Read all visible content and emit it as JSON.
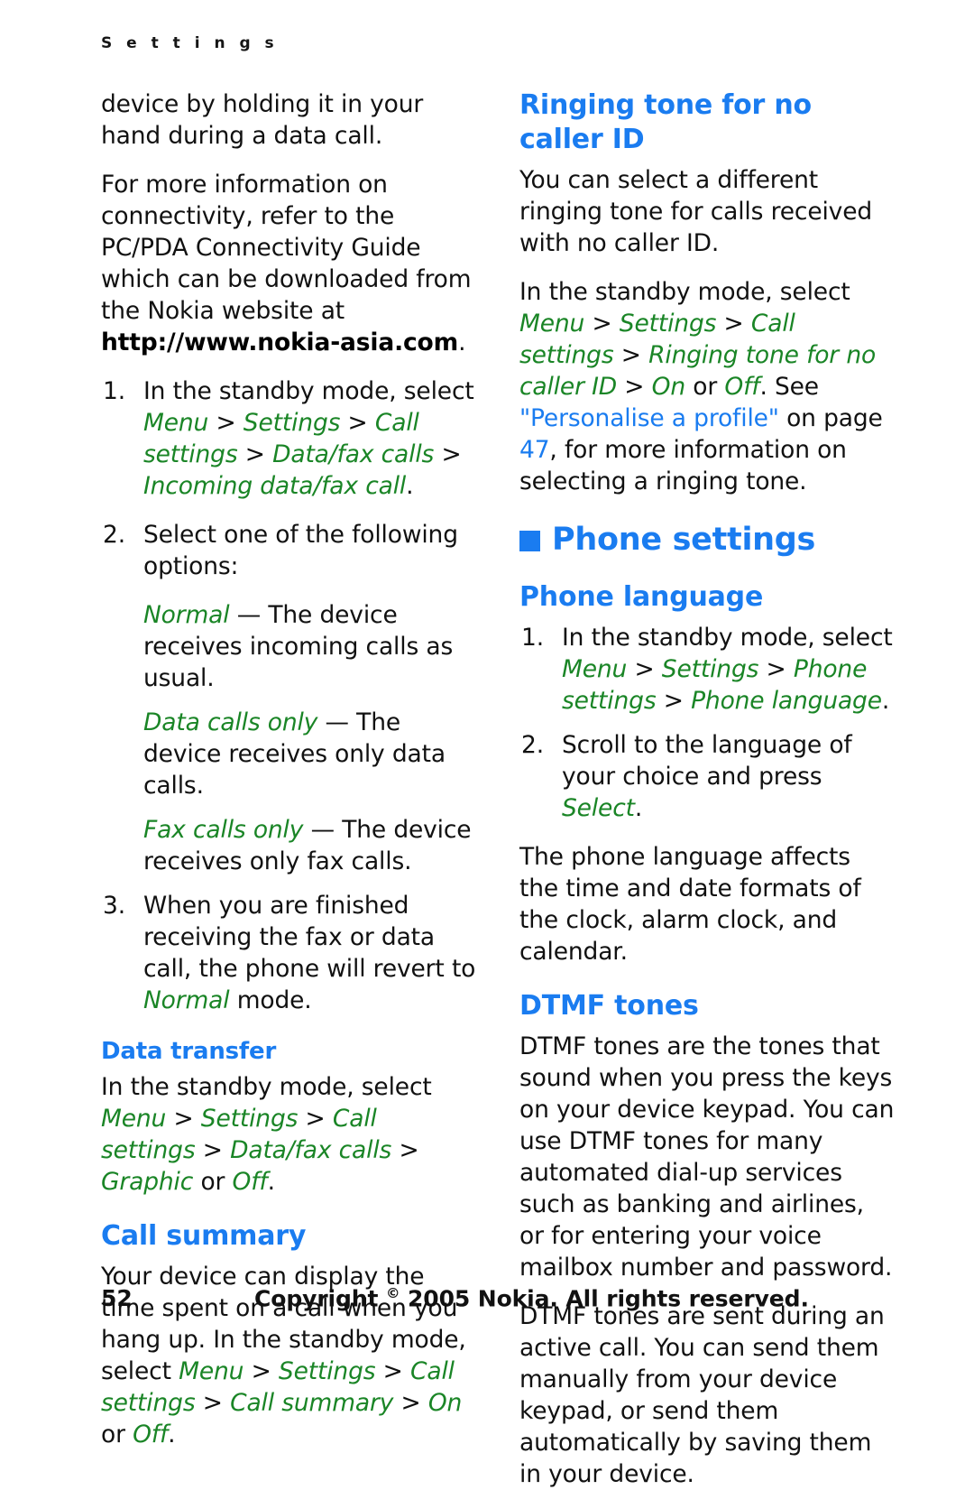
{
  "running_header": "S e t t i n g s",
  "colors": {
    "heading_blue": "#1a7cf0",
    "menu_green": "#1a8526",
    "body_black": "#111111"
  },
  "left_column": {
    "para_continued": "device by holding it in your hand during a data call.",
    "para_connectivity_pre": "For more information on connectivity, refer to the PC/PDA Connectivity Guide which can be downloaded from the Nokia website at ",
    "url": "http://www.nokia-asia.com",
    "para_connectivity_post": ".",
    "step1_num": "1.",
    "step1_text": "In the standby mode, select ",
    "step1_path": {
      "p1": "Menu",
      "p2": "Settings",
      "p3": "Call settings",
      "p4": "Data/fax calls",
      "p5": "Incoming data/fax call",
      "end": "."
    },
    "step2_num": "2.",
    "step2_text": "Select one of the following options:",
    "option_normal_term": "Normal",
    "option_normal_desc": " — The device receives incoming calls as usual.",
    "option_data_term": "Data calls only",
    "option_data_desc": " — The device receives only data calls.",
    "option_fax_term": "Fax calls only",
    "option_fax_desc": " — The device receives only fax calls.",
    "step3_num": "3.",
    "step3_text_a": "When you are finished receiving the fax or data call, the phone will revert to ",
    "step3_term": "Normal",
    "step3_text_b": " mode.",
    "data_transfer_heading": "Data transfer",
    "data_transfer_text": "In the standby mode, select ",
    "data_transfer_path": {
      "p1": "Menu",
      "p2": "Settings",
      "p3": "Call settings",
      "p4": "Data/fax calls",
      "p5": "Graphic",
      "or": " or ",
      "p6": "Off",
      "end": "."
    },
    "call_summary_heading": "Call summary",
    "call_summary_text": "Your device can display the time spent on a call when you hang up. In the standby mode, select ",
    "call_summary_path": {
      "p1": "Menu",
      "p2": "Settings",
      "p3": "Call settings",
      "p4": "Call summary",
      "p5": "On",
      "or": " or ",
      "p6": "Off",
      "end": "."
    }
  },
  "right_column": {
    "ringing_heading": "Ringing tone for no caller ID",
    "ringing_para1": "You can select a different ringing tone for calls received with no caller ID.",
    "ringing_para2_text": "In the standby mode, select ",
    "ringing_path": {
      "p1": "Menu",
      "p2": "Settings",
      "p3": "Call settings",
      "p4": "Ringing tone for no caller ID",
      "p5": "On",
      "or": " or ",
      "p6": "Off",
      "end": ". See "
    },
    "xref_title": "\"Personalise a profile\"",
    "xref_on_page": " on page ",
    "xref_page": "47",
    "xref_tail": ", for more information on selecting a ringing tone.",
    "phone_settings_heading": "Phone settings",
    "phone_language_heading": "Phone language",
    "pl_step1_num": "1.",
    "pl_step1_text": "In the standby mode, select ",
    "pl_step1_path": {
      "p1": "Menu",
      "p2": "Settings",
      "p3": "Phone settings",
      "p4": "Phone language",
      "end": "."
    },
    "pl_step2_num": "2.",
    "pl_step2_text_a": "Scroll to the language of your choice and press ",
    "pl_step2_term": "Select",
    "pl_step2_text_b": ".",
    "pl_para": "The phone language affects the time and date formats of the clock, alarm clock, and calendar.",
    "dtmf_heading": "DTMF tones",
    "dtmf_para1": "DTMF tones are the tones that sound when you press the keys on your device keypad. You can use DTMF tones for many automated dial-up services such as banking and airlines, or for entering your voice mailbox number and password.",
    "dtmf_para2": "DTMF tones are sent during an active call. You can send them manually from your device keypad, or send them automatically by saving them in your device."
  },
  "footer": {
    "page_number": "52",
    "copyright_pre": "Copyright ",
    "copyright_mark": "©",
    "copyright_post": " 2005 Nokia. All rights reserved."
  }
}
